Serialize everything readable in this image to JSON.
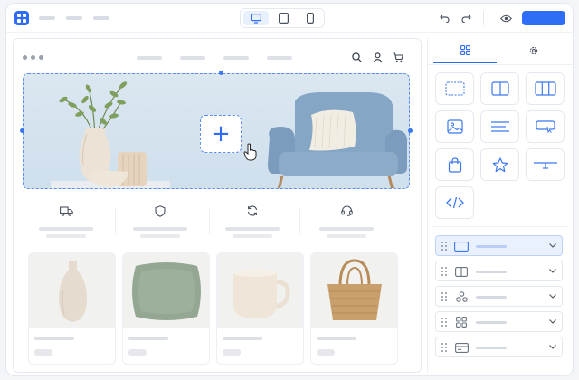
{
  "colors": {
    "accent": "#2f6df6",
    "selection": "#5a8ef0",
    "hero_bg": "#d4e3ee",
    "chair": "#87a6c4"
  },
  "toolbar": {
    "logo_icon": "grid-logo-icon",
    "device_modes": [
      "desktop",
      "tablet",
      "mobile"
    ],
    "active_device": "desktop",
    "actions": [
      "undo",
      "redo",
      "preview",
      "publish"
    ]
  },
  "canvas": {
    "header_icons": [
      "search",
      "user",
      "cart"
    ],
    "hero": {
      "add_block_label": "+",
      "images": [
        "vase-with-branches",
        "bowl",
        "ribbed-vase",
        "armchair",
        "cushion"
      ]
    },
    "features": [
      "truck-icon",
      "shield-icon",
      "refresh-icon",
      "headset-icon"
    ],
    "products": [
      "ceramic-vase",
      "green-cushion",
      "ceramic-mug",
      "woven-basket"
    ]
  },
  "panel": {
    "tabs": [
      {
        "icon": "grid-icon",
        "active": true
      },
      {
        "icon": "gear-icon",
        "active": false
      }
    ],
    "blocks": [
      "section",
      "two-columns",
      "three-columns",
      "image",
      "text",
      "button",
      "product",
      "star",
      "divider",
      "code"
    ],
    "layers": [
      {
        "icon": "section",
        "selected": true
      },
      {
        "icon": "columns",
        "selected": false
      },
      {
        "icon": "shapes",
        "selected": false
      },
      {
        "icon": "grid",
        "selected": false
      },
      {
        "icon": "card",
        "selected": false
      }
    ]
  }
}
